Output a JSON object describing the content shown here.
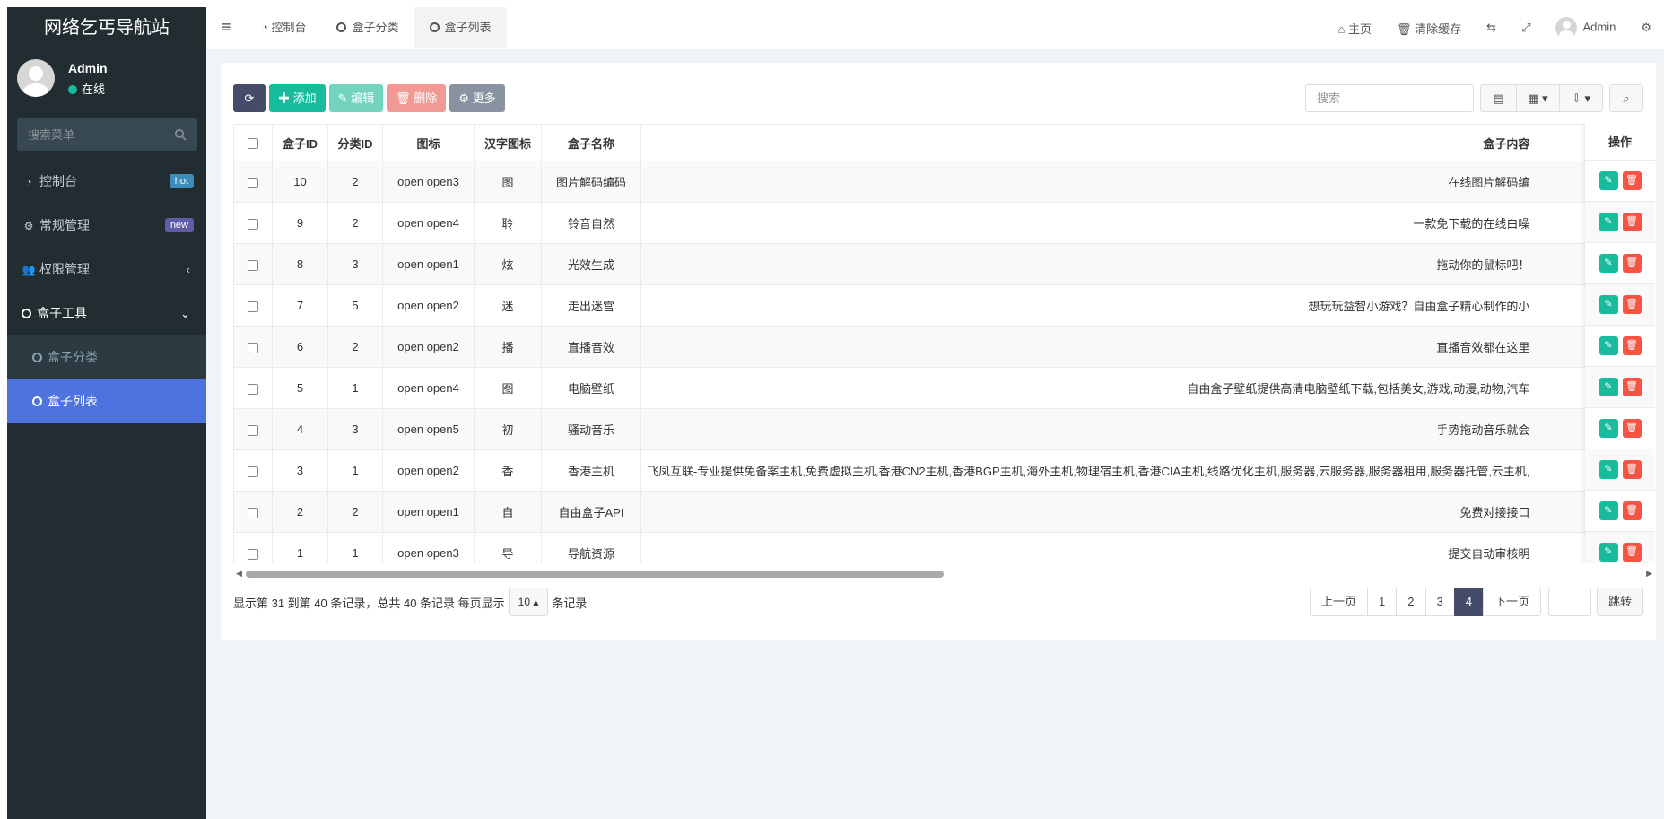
{
  "sidebar": {
    "logo": "网络乞丐导航站",
    "user": {
      "name": "Admin",
      "status": "在线",
      "status_color": "#18bc9c"
    },
    "search_placeholder": "搜索菜单",
    "menu": [
      {
        "label": "控制台",
        "icon": "dashboard-icon",
        "badge": "hot",
        "badge_color": "#3c8dbc"
      },
      {
        "label": "常规管理",
        "icon": "cogs-icon",
        "badge": "new",
        "badge_color": "#605ca8"
      },
      {
        "label": "权限管理",
        "icon": "users-icon",
        "arrow": "‹"
      },
      {
        "label": "盒子工具",
        "icon": "circle-icon",
        "arrow": "⌄"
      },
      {
        "label": "盒子分类",
        "icon": "circle-icon",
        "sub": true
      },
      {
        "label": "盒子列表",
        "icon": "circle-icon",
        "active": true
      }
    ],
    "active_color": "#4e73df"
  },
  "topbar": {
    "tabs": [
      {
        "label": "控制台",
        "icon": "dashboard-icon"
      },
      {
        "label": "盒子分类",
        "icon": "circle-icon"
      },
      {
        "label": "盒子列表",
        "icon": "circle-icon",
        "active": true
      }
    ],
    "home": "主页",
    "clear_cache": "清除缓存",
    "user": "Admin"
  },
  "toolbar": {
    "add": "添加",
    "edit": "编辑",
    "delete": "删除",
    "more": "更多",
    "search_placeholder": "搜索"
  },
  "table": {
    "headers": [
      "盒子ID",
      "分类ID",
      "图标",
      "汉字图标",
      "盒子名称",
      "盒子内容",
      "操作"
    ],
    "rows": [
      {
        "id": "10",
        "cat": "2",
        "icon": "open open3",
        "char": "图",
        "name": "图片解码编码",
        "content": "在线图片解码编"
      },
      {
        "id": "9",
        "cat": "2",
        "icon": "open open4",
        "char": "聆",
        "name": "铃音自然",
        "content": "一款免下载的在线白噪"
      },
      {
        "id": "8",
        "cat": "3",
        "icon": "open open1",
        "char": "炫",
        "name": "光效生成",
        "content": "拖动你的鼠标吧！"
      },
      {
        "id": "7",
        "cat": "5",
        "icon": "open open2",
        "char": "迷",
        "name": "走出迷宫",
        "content": "想玩玩益智小游戏？自由盒子精心制作的小"
      },
      {
        "id": "6",
        "cat": "2",
        "icon": "open open2",
        "char": "播",
        "name": "直播音效",
        "content": "直播音效都在这里"
      },
      {
        "id": "5",
        "cat": "1",
        "icon": "open open4",
        "char": "图",
        "name": "电脑壁纸",
        "content": "自由盒子壁纸提供高清电脑壁纸下载,包括美女,游戏,动漫,动物,汽车"
      },
      {
        "id": "4",
        "cat": "3",
        "icon": "open open5",
        "char": "初",
        "name": "骚动音乐",
        "content": "手势拖动音乐就会"
      },
      {
        "id": "3",
        "cat": "1",
        "icon": "open open2",
        "char": "香",
        "name": "香港主机",
        "content": "飞凤互联-专业提供免备案主机,免费虚拟主机,香港CN2主机,香港BGP主机,海外主机,物理宿主机,香港CIA主机,线路优化主机,服务器,云服务器,服务器租用,服务器托管,云主机,"
      },
      {
        "id": "2",
        "cat": "2",
        "icon": "open open1",
        "char": "自",
        "name": "自由盒子API",
        "content": "免费对接接口"
      },
      {
        "id": "1",
        "cat": "1",
        "icon": "open open3",
        "char": "导",
        "name": "导航资源",
        "content": "提交自动审核明"
      }
    ]
  },
  "pagination": {
    "info_prefix": "显示第 31 到第 40 条记录，总共 40 条记录 每页显示",
    "page_size": "10",
    "info_suffix": "条记录",
    "prev": "上一页",
    "pages": [
      "1",
      "2",
      "3",
      "4"
    ],
    "current": "4",
    "next": "下一页",
    "jump": "跳转"
  },
  "colors": {
    "sidebar_bg": "#222d32",
    "primary_dark": "#444c69",
    "success": "#18bc9c",
    "danger": "#f75444"
  }
}
